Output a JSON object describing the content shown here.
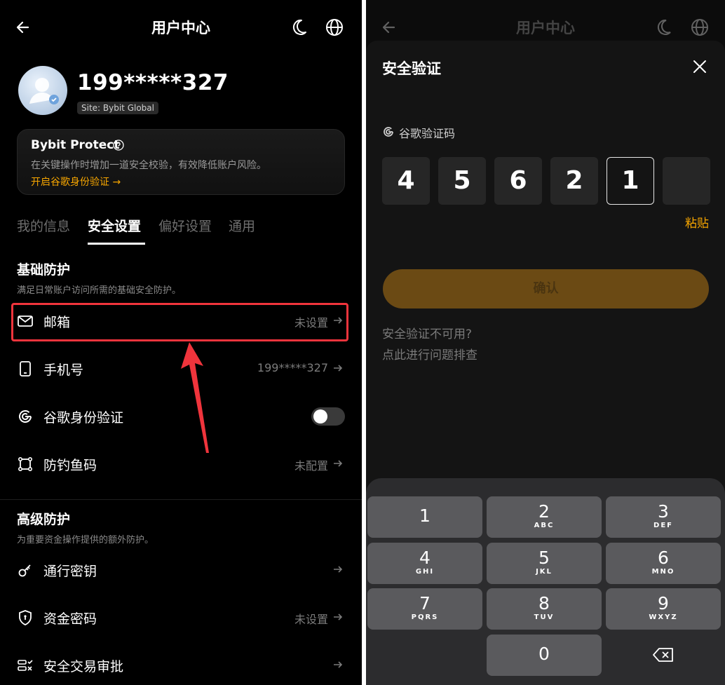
{
  "left": {
    "title": "用户中心",
    "user": {
      "uid": "199*****327",
      "site": "Site: Bybit Global"
    },
    "protect": {
      "title": "Bybit Protect",
      "desc": "在关键操作时增加一道安全校验，有效降低账户风险。",
      "link": "开启谷歌身份验证 →"
    },
    "tabs": [
      "我的信息",
      "安全设置",
      "偏好设置",
      "通用"
    ],
    "basic": {
      "title": "基础防护",
      "desc": "满足日常账户访问所需的基础安全防护。",
      "items": [
        {
          "label": "邮箱",
          "value": "未设置"
        },
        {
          "label": "手机号",
          "value": "199*****327"
        },
        {
          "label": "谷歌身份验证",
          "value": ""
        },
        {
          "label": "防钓鱼码",
          "value": "未配置"
        }
      ]
    },
    "advanced": {
      "title": "高级防护",
      "desc": "为重要资金操作提供的额外防护。",
      "items": [
        {
          "label": "通行密钥",
          "value": ""
        },
        {
          "label": "资金密码",
          "value": "未设置"
        },
        {
          "label": "安全交易审批",
          "value": ""
        }
      ]
    },
    "toggle_google_auth": false,
    "highlight_color": "#f0343c"
  },
  "right": {
    "bg_title": "用户中心",
    "sheet_title": "安全验证",
    "auth_label": "谷歌验证码",
    "code_digits": [
      "4",
      "5",
      "6",
      "2",
      "1",
      ""
    ],
    "paste_label": "粘贴",
    "confirm_label": "确认",
    "help_line1": "安全验证不可用?",
    "help_line2": "点此进行问题排查",
    "keypad": [
      {
        "num": "1",
        "letters": ""
      },
      {
        "num": "2",
        "letters": "ABC"
      },
      {
        "num": "3",
        "letters": "DEF"
      },
      {
        "num": "4",
        "letters": "GHI"
      },
      {
        "num": "5",
        "letters": "JKL"
      },
      {
        "num": "6",
        "letters": "MNO"
      },
      {
        "num": "7",
        "letters": "PQRS"
      },
      {
        "num": "8",
        "letters": "TUV"
      },
      {
        "num": "9",
        "letters": "WXYZ"
      },
      {
        "num": "0",
        "letters": ""
      }
    ]
  },
  "colors": {
    "accent": "#f7a600",
    "confirm_bg": "#6b4a14"
  },
  "icons": [
    "back-arrow-icon",
    "moon-icon",
    "globe-icon",
    "mail-icon",
    "phone-icon",
    "google-icon",
    "anti-phishing-icon",
    "key-icon",
    "shield-icon",
    "approval-icon",
    "close-icon",
    "backspace-icon"
  ]
}
